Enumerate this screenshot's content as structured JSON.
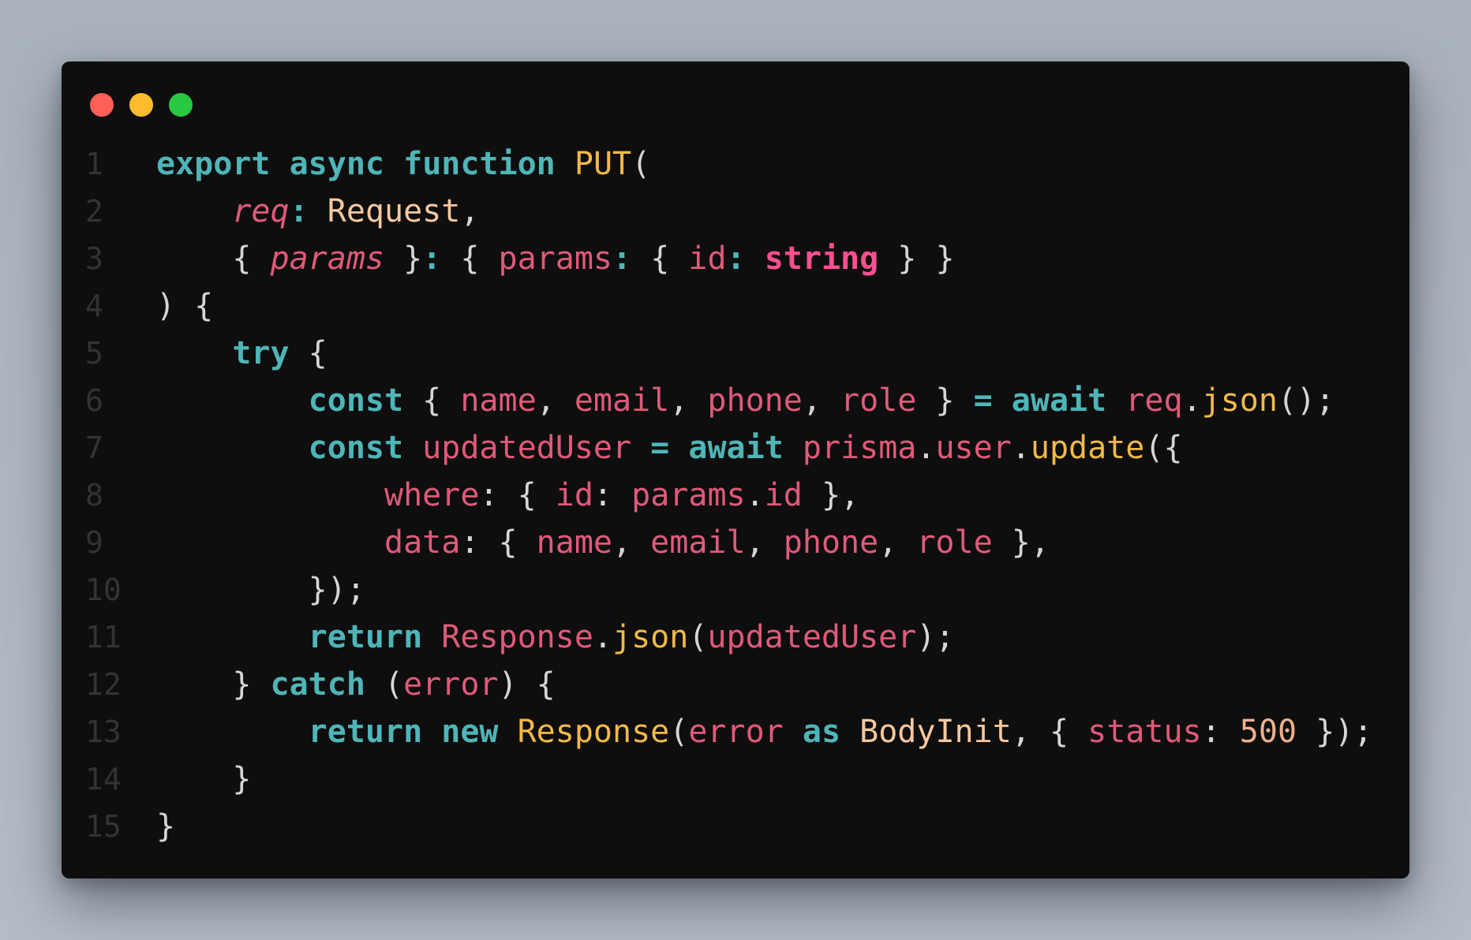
{
  "colors": {
    "background": "#b0b8c2",
    "window": "#0e0e0e",
    "close": "#ff5f57",
    "minimize": "#febc2e",
    "maximize": "#28c840",
    "keyword": "#4eb5b8",
    "variable": "#e05a7a",
    "function": "#f2b94a",
    "type": "#f7c8a0",
    "string_type": "#ff4f91",
    "number": "#f0b08a",
    "punctuation": "#d6d6d6",
    "line_number": "#333333"
  },
  "window_controls": [
    {
      "name": "close-button",
      "color": "#ff5f57"
    },
    {
      "name": "minimize-button",
      "color": "#febc2e"
    },
    {
      "name": "maximize-button",
      "color": "#28c840"
    }
  ],
  "lines": [
    {
      "num": "1",
      "tokens": [
        {
          "t": "export",
          "c": "kw"
        },
        {
          "t": " ",
          "c": "punc"
        },
        {
          "t": "async",
          "c": "kw"
        },
        {
          "t": " ",
          "c": "punc"
        },
        {
          "t": "function",
          "c": "kw"
        },
        {
          "t": " ",
          "c": "punc"
        },
        {
          "t": "PUT",
          "c": "fn"
        },
        {
          "t": "(",
          "c": "punc"
        }
      ]
    },
    {
      "num": "2",
      "tokens": [
        {
          "t": "    ",
          "c": "punc"
        },
        {
          "t": "req",
          "c": "var ital"
        },
        {
          "t": ": ",
          "c": "kw"
        },
        {
          "t": "Request",
          "c": "type"
        },
        {
          "t": ",",
          "c": "punc"
        }
      ]
    },
    {
      "num": "3",
      "tokens": [
        {
          "t": "    { ",
          "c": "punc"
        },
        {
          "t": "params",
          "c": "var ital"
        },
        {
          "t": " }",
          "c": "punc"
        },
        {
          "t": ":",
          "c": "kw"
        },
        {
          "t": " { ",
          "c": "punc"
        },
        {
          "t": "params",
          "c": "var"
        },
        {
          "t": ":",
          "c": "kw"
        },
        {
          "t": " { ",
          "c": "punc"
        },
        {
          "t": "id",
          "c": "var"
        },
        {
          "t": ":",
          "c": "kw"
        },
        {
          "t": " ",
          "c": "punc"
        },
        {
          "t": "string",
          "c": "str"
        },
        {
          "t": " } }",
          "c": "punc"
        }
      ]
    },
    {
      "num": "4",
      "tokens": [
        {
          "t": ") {",
          "c": "punc"
        }
      ]
    },
    {
      "num": "5",
      "tokens": [
        {
          "t": "    ",
          "c": "punc"
        },
        {
          "t": "try",
          "c": "kw"
        },
        {
          "t": " {",
          "c": "punc"
        }
      ]
    },
    {
      "num": "6",
      "tokens": [
        {
          "t": "        ",
          "c": "punc"
        },
        {
          "t": "const",
          "c": "kw"
        },
        {
          "t": " { ",
          "c": "punc"
        },
        {
          "t": "name",
          "c": "var"
        },
        {
          "t": ", ",
          "c": "punc"
        },
        {
          "t": "email",
          "c": "var"
        },
        {
          "t": ", ",
          "c": "punc"
        },
        {
          "t": "phone",
          "c": "var"
        },
        {
          "t": ", ",
          "c": "punc"
        },
        {
          "t": "role",
          "c": "var"
        },
        {
          "t": " } ",
          "c": "punc"
        },
        {
          "t": "=",
          "c": "kw"
        },
        {
          "t": " ",
          "c": "punc"
        },
        {
          "t": "await",
          "c": "kw"
        },
        {
          "t": " ",
          "c": "punc"
        },
        {
          "t": "req",
          "c": "var"
        },
        {
          "t": ".",
          "c": "punc"
        },
        {
          "t": "json",
          "c": "fn"
        },
        {
          "t": "();",
          "c": "punc"
        }
      ]
    },
    {
      "num": "7",
      "tokens": [
        {
          "t": "        ",
          "c": "punc"
        },
        {
          "t": "const",
          "c": "kw"
        },
        {
          "t": " ",
          "c": "punc"
        },
        {
          "t": "updatedUser",
          "c": "var"
        },
        {
          "t": " ",
          "c": "punc"
        },
        {
          "t": "=",
          "c": "kw"
        },
        {
          "t": " ",
          "c": "punc"
        },
        {
          "t": "await",
          "c": "kw"
        },
        {
          "t": " ",
          "c": "punc"
        },
        {
          "t": "prisma",
          "c": "var"
        },
        {
          "t": ".",
          "c": "punc"
        },
        {
          "t": "user",
          "c": "var"
        },
        {
          "t": ".",
          "c": "punc"
        },
        {
          "t": "update",
          "c": "fn"
        },
        {
          "t": "({",
          "c": "punc"
        }
      ]
    },
    {
      "num": "8",
      "tokens": [
        {
          "t": "            ",
          "c": "punc"
        },
        {
          "t": "where",
          "c": "var"
        },
        {
          "t": ":",
          "c": "punc"
        },
        {
          "t": " { ",
          "c": "punc"
        },
        {
          "t": "id",
          "c": "var"
        },
        {
          "t": ":",
          "c": "punc"
        },
        {
          "t": " ",
          "c": "punc"
        },
        {
          "t": "params",
          "c": "var"
        },
        {
          "t": ".",
          "c": "punc"
        },
        {
          "t": "id",
          "c": "var"
        },
        {
          "t": " },",
          "c": "punc"
        }
      ]
    },
    {
      "num": "9",
      "tokens": [
        {
          "t": "            ",
          "c": "punc"
        },
        {
          "t": "data",
          "c": "var"
        },
        {
          "t": ":",
          "c": "punc"
        },
        {
          "t": " { ",
          "c": "punc"
        },
        {
          "t": "name",
          "c": "var"
        },
        {
          "t": ", ",
          "c": "punc"
        },
        {
          "t": "email",
          "c": "var"
        },
        {
          "t": ", ",
          "c": "punc"
        },
        {
          "t": "phone",
          "c": "var"
        },
        {
          "t": ", ",
          "c": "punc"
        },
        {
          "t": "role",
          "c": "var"
        },
        {
          "t": " },",
          "c": "punc"
        }
      ]
    },
    {
      "num": "10",
      "tokens": [
        {
          "t": "        ",
          "c": "punc"
        },
        {
          "t": "});",
          "c": "punc"
        }
      ]
    },
    {
      "num": "11",
      "tokens": [
        {
          "t": "        ",
          "c": "punc"
        },
        {
          "t": "return",
          "c": "kw"
        },
        {
          "t": " ",
          "c": "punc"
        },
        {
          "t": "Response",
          "c": "var"
        },
        {
          "t": ".",
          "c": "punc"
        },
        {
          "t": "json",
          "c": "fn"
        },
        {
          "t": "(",
          "c": "punc"
        },
        {
          "t": "updatedUser",
          "c": "var"
        },
        {
          "t": ");",
          "c": "punc"
        }
      ]
    },
    {
      "num": "12",
      "tokens": [
        {
          "t": "    } ",
          "c": "punc"
        },
        {
          "t": "catch",
          "c": "kw"
        },
        {
          "t": " (",
          "c": "punc"
        },
        {
          "t": "error",
          "c": "var"
        },
        {
          "t": ") {",
          "c": "punc"
        }
      ]
    },
    {
      "num": "13",
      "tokens": [
        {
          "t": "        ",
          "c": "punc"
        },
        {
          "t": "return",
          "c": "kw"
        },
        {
          "t": " ",
          "c": "punc"
        },
        {
          "t": "new",
          "c": "kw"
        },
        {
          "t": " ",
          "c": "punc"
        },
        {
          "t": "Response",
          "c": "fn"
        },
        {
          "t": "(",
          "c": "punc"
        },
        {
          "t": "error",
          "c": "var"
        },
        {
          "t": " ",
          "c": "punc"
        },
        {
          "t": "as",
          "c": "kw"
        },
        {
          "t": " ",
          "c": "punc"
        },
        {
          "t": "BodyInit",
          "c": "type"
        },
        {
          "t": ", { ",
          "c": "punc"
        },
        {
          "t": "status",
          "c": "var"
        },
        {
          "t": ":",
          "c": "punc"
        },
        {
          "t": " ",
          "c": "punc"
        },
        {
          "t": "500",
          "c": "num"
        },
        {
          "t": " });",
          "c": "punc"
        }
      ]
    },
    {
      "num": "14",
      "tokens": [
        {
          "t": "    }",
          "c": "punc"
        }
      ]
    },
    {
      "num": "15",
      "tokens": [
        {
          "t": "}",
          "c": "punc"
        }
      ]
    }
  ]
}
